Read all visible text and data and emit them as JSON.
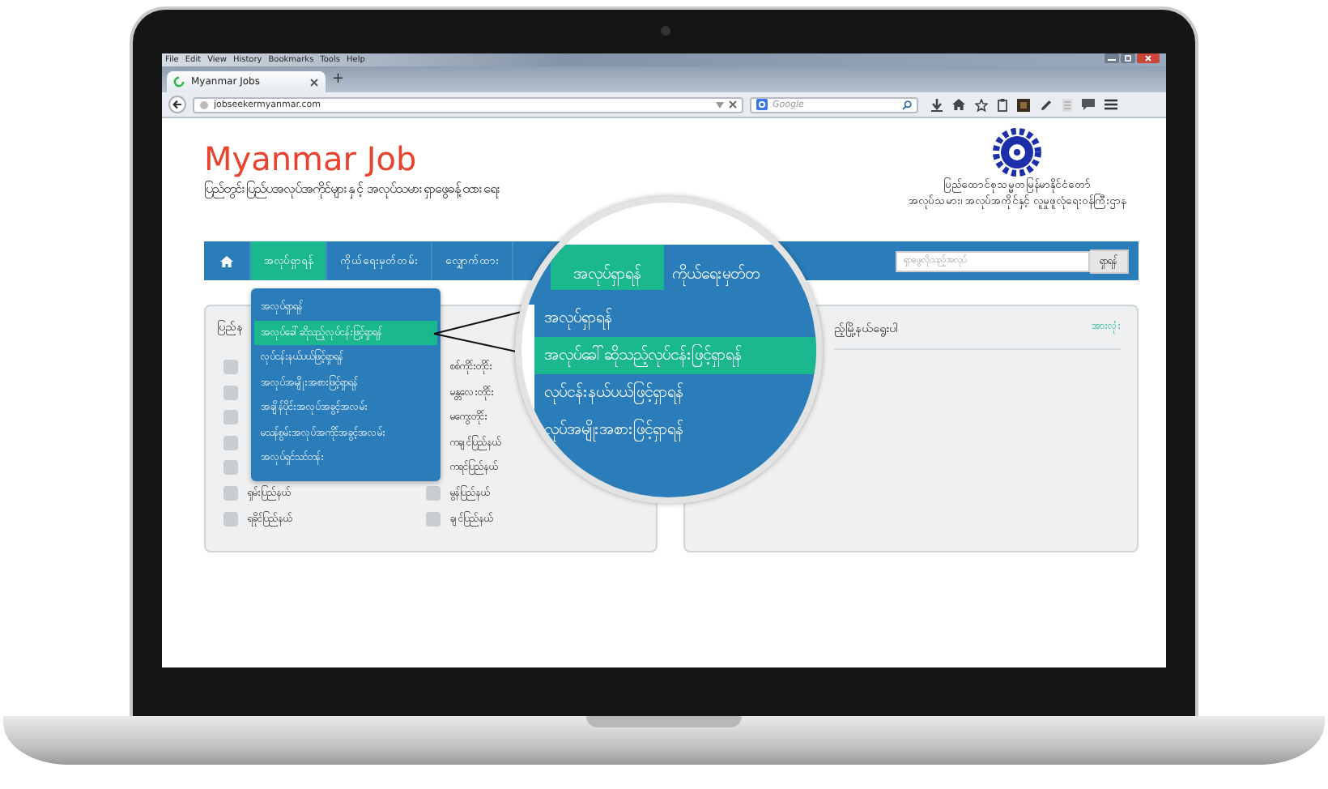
{
  "browser": {
    "menu": [
      "File",
      "Edit",
      "View",
      "History",
      "Bookmarks",
      "Tools",
      "Help"
    ],
    "tab": {
      "title": "Myanmar Jobs",
      "new_tab": "+"
    },
    "address": "jobseekermyanmar.com",
    "search_placeholder": "Google"
  },
  "header": {
    "title": "Myanmar Job",
    "subtitle": "ပြည်တွင်းပြည်ပအလုပ်အကိုင်များနှင့် အလုပ်သမားရှာဖွေခန့်ထားရေး",
    "ministry": [
      "ပြည်ထောင်စုသမ္မတမြန်မာနိုင်ငံတော်",
      "အလုပ်သမား၊ အလုပ်အကိုင်နှင့် လူမှုဖူလုံရေးဝန်ကြီးဌာန"
    ]
  },
  "nav": {
    "items": [
      {
        "label": "အလုပ်ရှာရန်",
        "selected": true
      },
      {
        "label": "ကိုယ်ရေးမှတ်တမ်း",
        "selected": false
      },
      {
        "label": "လျှောက်ထား",
        "selected": false
      }
    ],
    "search": {
      "placeholder": "ရှာဖွေလိုသည့်အလုပ်",
      "button": "ရှာရန်"
    }
  },
  "dropdown": [
    {
      "label": "အလုပ်ရှာရန်",
      "selected": false
    },
    {
      "label": "အလုပ်ခေါ်ဆိုသည့်လုပ်ငန်းဖြင့်ရှာရန်",
      "selected": true
    },
    {
      "label": "လုပ်ငန်းနယ်ပယ်ဖြင့်ရှာရန်",
      "selected": false
    },
    {
      "label": "အလုပ်အမျိုးအစားဖြင့်ရှာရန်",
      "selected": false
    },
    {
      "label": "အချိန်ပိုင်းအလုပ်အခွင့်အလမ်း",
      "selected": false
    },
    {
      "label": "မသန်စွမ်းအလုပ်အကိုင်အခွင့်အလမ်း",
      "selected": false
    },
    {
      "label": "အလုပ်ရှင်သင်တန်း",
      "selected": false
    }
  ],
  "left_panel": {
    "heading": "ပြည်န",
    "column_1": [
      {
        "checked": false
      },
      {
        "checked": false
      },
      {
        "checked": false
      },
      {
        "checked": false
      },
      {
        "checked": false
      },
      {
        "label": "ရှမ်းပြည်နယ်",
        "checked": false
      },
      {
        "label": "ရခိုင်ပြည်နယ်",
        "checked": false
      }
    ],
    "column_2": [
      {
        "label": "စစ်ကိုင်းတိုင်း"
      },
      {
        "label": "မန္တလေးတိုင်း"
      },
      {
        "label": "မကွေးတိုင်း"
      },
      {
        "label": "ကချင်ပြည်နယ်"
      },
      {
        "label": "ကရင်ပြည်နယ်"
      },
      {
        "label": "မွန်ပြည်နယ်",
        "checked": false
      },
      {
        "label": "ချင်ပြည်နယ်",
        "checked": false
      }
    ]
  },
  "right_panel": {
    "heading": "ည့်မြို့နယ်ရွေးပါ",
    "link": "အားလုံး"
  },
  "magnifier": {
    "nav": [
      {
        "label": "အလုပ်ရှာရန်",
        "selected": true
      },
      {
        "label": "ကိုယ်ရေးမှတ်တ",
        "selected": false
      }
    ],
    "menu": [
      {
        "label": "အလုပ်ရှာရန်",
        "selected": false
      },
      {
        "label": "အလုပ်ခေါ်ဆိုသည့်လုပ်ငန်းဖြင့်ရှာရန်",
        "selected": true
      },
      {
        "label": "လုပ်ငန်းနယ်ပယ်ဖြင့်ရှာရန်",
        "selected": false
      },
      {
        "label": "လုပ်အမျိုးအစားဖြင့်ရှာရန်",
        "selected": false
      }
    ]
  }
}
